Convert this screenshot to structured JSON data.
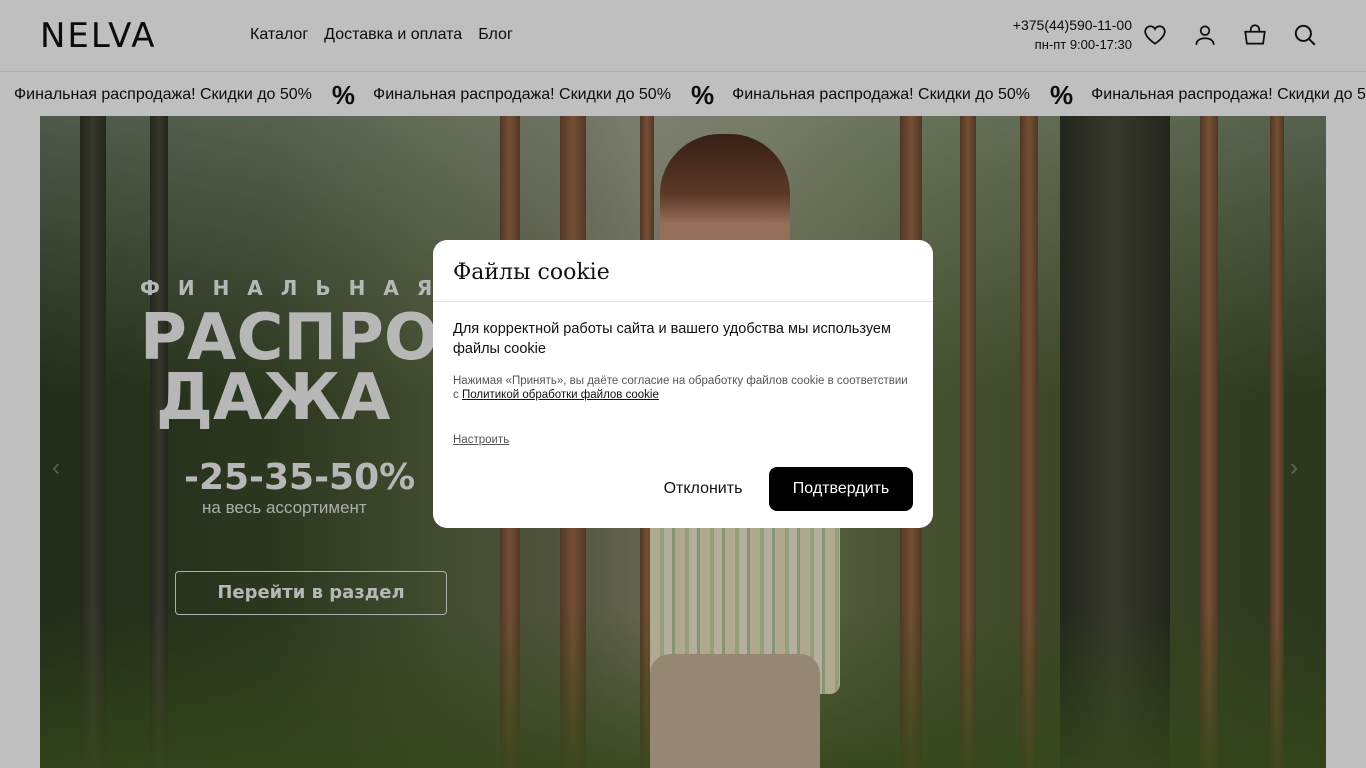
{
  "header": {
    "logo": "NELVA",
    "nav": [
      {
        "label": "Каталог"
      },
      {
        "label": "Доставка и оплата"
      },
      {
        "label": "Блог"
      }
    ],
    "phone": "+375(44)590-11-00",
    "hours": "пн-пт 9:00-17:30",
    "icons": [
      "heart-icon",
      "user-icon",
      "bag-icon",
      "search-icon"
    ]
  },
  "marquee": {
    "message": "Финальная распродажа! Скидки до 50%",
    "separator": "%"
  },
  "hero": {
    "subtitle": "ФИНАЛЬНАЯ",
    "title_line1": "РАСПРО",
    "title_line2": "ДАЖА",
    "discount": "-25-35-50%",
    "scope": "на весь ассортимент",
    "button": "Перейти в раздел"
  },
  "cookie_modal": {
    "title": "Файлы cookie",
    "body": "Для корректной работы сайта и вашего удобства мы используем файлы cookie",
    "note_prefix": "Нажимая «Принять», вы даёте согласие на обработку файлов cookie в соответствии с ",
    "note_link": "Политикой обработки файлов cookie",
    "configure": "Настроить",
    "decline": "Отклонить",
    "accept": "Подтвердить"
  }
}
